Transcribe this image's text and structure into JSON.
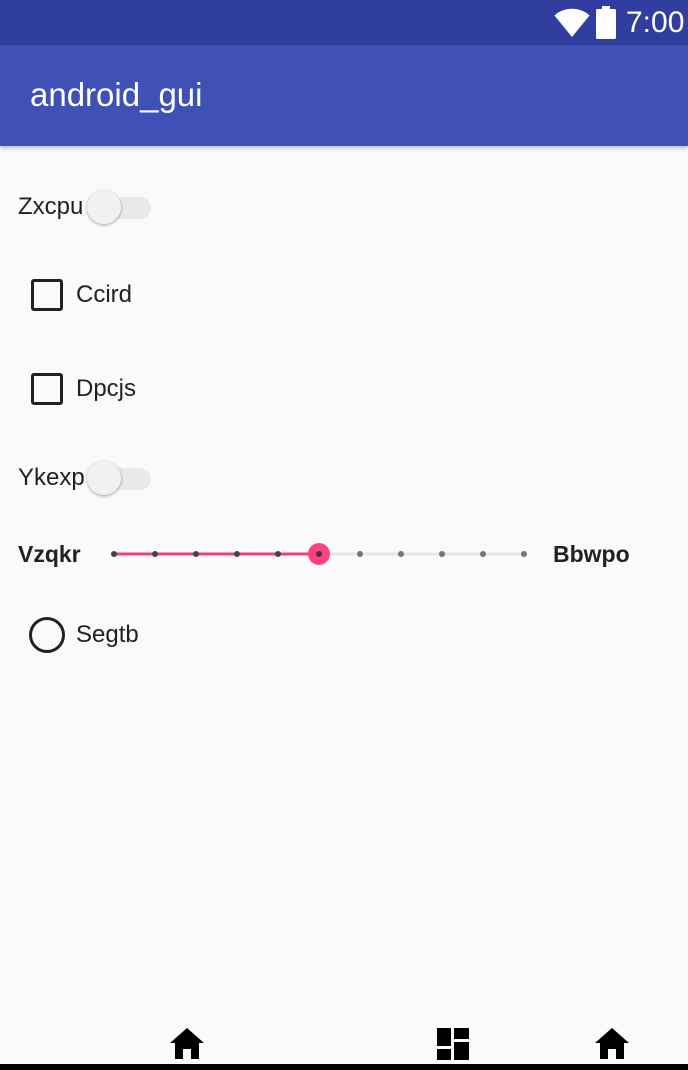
{
  "status_bar": {
    "time": "7:00",
    "wifi_icon": "wifi-icon",
    "battery_icon": "battery-icon"
  },
  "app_bar": {
    "title": "android_gui"
  },
  "controls": {
    "switch_1": {
      "label": "Zxcpu",
      "checked": false
    },
    "checkbox_1": {
      "label": "Ccird",
      "checked": false
    },
    "checkbox_2": {
      "label": "Dpcjs",
      "checked": false
    },
    "switch_2": {
      "label": "Ykexp",
      "checked": false
    },
    "slider": {
      "left_label": "Vzqkr",
      "right_label": "Bbwpo",
      "steps": 10,
      "value": 5
    },
    "radio_1": {
      "label": "Segtb",
      "checked": false
    }
  },
  "bottom_nav": {
    "items": [
      {
        "icon": "home-icon"
      },
      {
        "icon": "dashboard-icon"
      },
      {
        "icon": "home-icon"
      }
    ]
  },
  "colors": {
    "status_bar": "#303f9f",
    "app_bar": "#3f51b5",
    "accent": "#ff4081",
    "slider_accent": "#ec407a",
    "background": "#fafafa"
  }
}
